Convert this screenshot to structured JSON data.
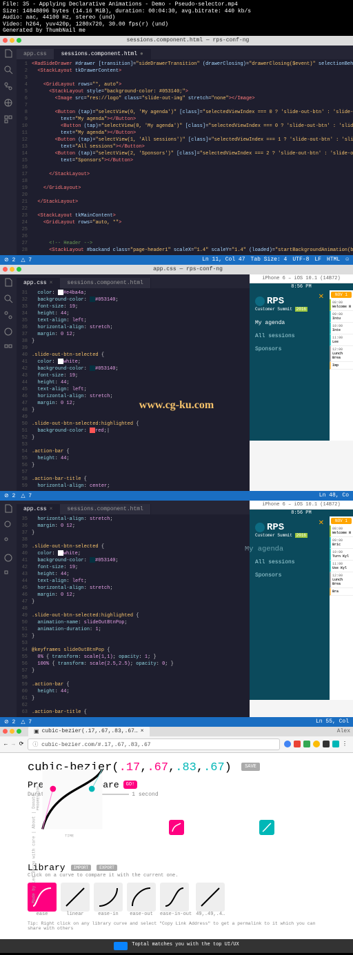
{
  "meta": {
    "l1": "File: 35 - Applying Declarative Animations - Demo - Pseudo-selector.mp4",
    "l2": "Size: 14848896 bytes (14.16 MiB), duration: 00:04:30, avg.bitrate: 440 kb/s",
    "l3": "Audio: aac, 44100 Hz, stereo (und)",
    "l4": "Video: h264, yuv420p, 1280x720, 30.00 fps(r) (und)",
    "l5": "Generated by ThumbNail me"
  },
  "tabs": {
    "css": "app.css",
    "html": "sessions.component.html"
  },
  "pane1": {
    "lines": [
      {
        "n": "1",
        "h": "<span class='t-tag'>&lt;RadSideDrawer</span> <span class='t-attr'>#drawer</span> <span class='t-attr'>[transition]</span>=<span class='t-str'>\"sideDrawerTransition\"</span> <span class='t-attr'>(drawerClosing)</span>=<span class='t-str'>\"drawerClosing($event)\"</span> <span class='t-attr'>selectionBehavior</span>=<span class='t-str'>\"None\"</span><span class='t-tag'>&gt;</span>"
      },
      {
        "n": "2",
        "h": "  <span class='t-tag'>&lt;StackLayout</span> <span class='t-attr'>tkDrawerContent</span><span class='t-tag'>&gt;</span>"
      },
      {
        "n": "3",
        "h": ""
      },
      {
        "n": "4",
        "h": "    <span class='t-tag'>&lt;GridLayout</span> <span class='t-attr'>rows</span>=<span class='t-str'>\"*, auto\"</span><span class='t-tag'>&gt;</span>"
      },
      {
        "n": "5",
        "h": "      <span class='t-tag'>&lt;StackLayout</span> <span class='t-attr'>style</span>=<span class='t-str'>\"background-color: #053140;\"</span><span class='t-tag'>&gt;</span>"
      },
      {
        "n": "6",
        "h": "        <span class='t-tag'>&lt;Image</span> <span class='t-attr'>src</span>=<span class='t-str'>\"res://logo\"</span> <span class='t-attr'>class</span>=<span class='t-str'>\"slide-out-img\"</span> <span class='t-attr'>stretch</span>=<span class='t-str'>\"none\"</span><span class='t-tag'>&gt;&lt;/Image&gt;</span>"
      },
      {
        "n": "7",
        "h": ""
      },
      {
        "n": "8",
        "h": "        <span class='t-tag'>&lt;Button</span> <span class='t-attr'>(tap)</span>=<span class='t-str'>\"selectView(0, 'My agenda')\"</span> <span class='t-attr'>[class]</span>=<span class='t-str'>\"selectedViewIndex === 0 ? 'slide-out-btn' : 'slide-out-btn-sel</span>"
      },
      {
        "n": "9",
        "h": "          <span class='t-attr'>text</span>=<span class='t-str'>\"My agenda\"</span><span class='t-tag'>&gt;&lt;/Button&gt;</span>"
      },
      {
        "n": "10",
        "h": "          <span class='t-tag'>&lt;Button</span> <span class='t-attr'>(tap)</span>=<span class='t-str'>\"selectView(0, 'My agenda')\"</span> <span class='t-attr'>[class]</span>=<span class='t-str'>\"selectedViewIndex === 0 ? 'slide-out-btn' : 'slide-out-btn</span>"
      },
      {
        "n": "11",
        "h": "          <span class='t-attr'>text</span>=<span class='t-str'>\"My agenda\"</span><span class='t-tag'>&gt;&lt;/Button&gt;</span>"
      },
      {
        "n": "12",
        "h": "        <span class='t-tag'>&lt;Button</span> <span class='t-attr'>(tap)</span>=<span class='t-str'>\"selectView(1, 'All sessions')\"</span> <span class='t-attr'>[class]</span>=<span class='t-str'>\"selectedViewIndex === 1 ? 'slide-out-btn' : 'slide-out-btn-se</span>"
      },
      {
        "n": "13",
        "h": "          <span class='t-attr'>text</span>=<span class='t-str'>\"All sessions\"</span><span class='t-tag'>&gt;&lt;/Button&gt;</span>"
      },
      {
        "n": "14",
        "h": "        <span class='t-tag'>&lt;Button</span> <span class='t-attr'>(tap)</span>=<span class='t-str'>\"selectView(2, 'Sponsors')\"</span> <span class='t-attr'>[class]</span>=<span class='t-str'>\"selectedViewIndex === 2 ? 'slide-out-btn' : 'slide-out-btn-select</span>"
      },
      {
        "n": "15",
        "h": "          <span class='t-attr'>text</span>=<span class='t-str'>\"Sponsors\"</span><span class='t-tag'>&gt;&lt;/Button&gt;</span>"
      },
      {
        "n": "16",
        "h": ""
      },
      {
        "n": "17",
        "h": "      <span class='t-tag'>&lt;/StackLayout&gt;</span>"
      },
      {
        "n": "18",
        "h": ""
      },
      {
        "n": "19",
        "h": "    <span class='t-tag'>&lt;/GridLayout&gt;</span>"
      },
      {
        "n": "20",
        "h": ""
      },
      {
        "n": "21",
        "h": "  <span class='t-tag'>&lt;/StackLayout&gt;</span>"
      },
      {
        "n": "22",
        "h": ""
      },
      {
        "n": "23",
        "h": "  <span class='t-tag'>&lt;StackLayout</span> <span class='t-attr'>tkMainContent</span><span class='t-tag'>&gt;</span>"
      },
      {
        "n": "24",
        "h": "    <span class='t-tag'>&lt;GridLayout</span> <span class='t-attr'>rows</span>=<span class='t-str'>\"auto, *\"</span><span class='t-tag'>&gt;</span>"
      },
      {
        "n": "25",
        "h": ""
      },
      {
        "n": "26",
        "h": ""
      },
      {
        "n": "27",
        "h": "      <span style='color:#6a9955'>&lt;!-- Header --&gt;</span>"
      },
      {
        "n": "28",
        "h": "      <span class='t-tag'>&lt;StackLayout</span> <span class='t-attr'>#backand</span> <span class='t-attr'>class</span>=<span class='t-str'>\"page-header1\"</span> <span class='t-attr'>scaleX</span>=<span class='t-str'>\"1.4\"</span> <span class='t-attr'>scaleY</span>=<span class='t-str'>\"1.4\"</span> <span class='t-attr'>(loaded)</span>=<span class='t-str'>\"startBackgroundAnimation(backgroun</span>"
      }
    ]
  },
  "status1": {
    "left": [
      "⊘ 2",
      "△ 7"
    ],
    "right": [
      "Ln 11, Col 47",
      "Tab Size: 4",
      "UTF-8",
      "LF",
      "HTML",
      "☺"
    ]
  },
  "titlebar": {
    "main": "sessions.component.html — rps-conf-ng",
    "sub": "app.css — rps-conf-ng"
  },
  "pane2": {
    "lines": [
      {
        "n": "31",
        "h": "  <span class='t-prop'>color</span>: <span class='sw-w'></span><span class='t-val'>#e4ba4a</span>;"
      },
      {
        "n": "32",
        "h": "  <span class='t-prop'>background-color</span>: <span class='sw-d'></span><span class='t-val'>#053140</span>;"
      },
      {
        "n": "33",
        "h": "  <span class='t-prop'>font-size</span>: <span class='t-val'>19</span>;"
      },
      {
        "n": "34",
        "h": "  <span class='t-prop'>height</span>: <span class='t-val'>44</span>;"
      },
      {
        "n": "35",
        "h": "  <span class='t-prop'>text-align</span>: <span class='t-val'>left</span>;"
      },
      {
        "n": "36",
        "h": "  <span class='t-prop'>horizontal-align</span>: <span class='t-val'>stretch</span>;"
      },
      {
        "n": "37",
        "h": "  <span class='t-prop'>margin</span>: <span class='t-val'>0 12</span>;"
      },
      {
        "n": "38",
        "h": "}"
      },
      {
        "n": "39",
        "h": ""
      },
      {
        "n": "40",
        "h": "<span class='t-sel'>.slide-out-btn-selected</span> {"
      },
      {
        "n": "41",
        "h": "  <span class='t-prop'>color</span>: <span class='sw-w'></span><span class='t-val'>white</span>;"
      },
      {
        "n": "42",
        "h": "  <span class='t-prop'>background-color</span>: <span class='sw-d'></span><span class='t-val'>#053140</span>;"
      },
      {
        "n": "43",
        "h": "  <span class='t-prop'>font-size</span>: <span class='t-val'>19</span>;"
      },
      {
        "n": "44",
        "h": "  <span class='t-prop'>height</span>: <span class='t-val'>44</span>;"
      },
      {
        "n": "45",
        "h": "  <span class='t-prop'>text-align</span>: <span class='t-val'>left</span>;"
      },
      {
        "n": "46",
        "h": "  <span class='t-prop'>horizontal-align</span>: <span class='t-val'>stretch</span>;"
      },
      {
        "n": "47",
        "h": "  <span class='t-prop'>margin</span>: <span class='t-val'>0 12</span>;"
      },
      {
        "n": "48",
        "h": "}"
      },
      {
        "n": "49",
        "h": ""
      },
      {
        "n": "50",
        "h": "<span class='t-sel'>.slide-out-btn-selected:highlighted</span> {"
      },
      {
        "n": "51",
        "h": "  <span class='t-prop'>background-color</span>: <span class='sw-r'></span><span class='t-val'>red</span>;|"
      },
      {
        "n": "52",
        "h": "}"
      },
      {
        "n": "53",
        "h": ""
      },
      {
        "n": "54",
        "h": "<span class='t-sel'>.action-bar</span> {"
      },
      {
        "n": "55",
        "h": "  <span class='t-prop'>height</span>: <span class='t-val'>44</span>;"
      },
      {
        "n": "56",
        "h": "}"
      },
      {
        "n": "57",
        "h": ""
      },
      {
        "n": "58",
        "h": "<span class='t-sel'>.action-bar-title</span> {"
      },
      {
        "n": "59",
        "h": "  <span class='t-prop'>horizontal-align</span>: <span class='t-val'>center</span>;"
      }
    ]
  },
  "status2": {
    "left": [
      "⊘ 2",
      "△ 7"
    ],
    "right": [
      "Ln 48, Co"
    ]
  },
  "pane3": {
    "lines": [
      {
        "n": "35",
        "h": "  <span class='t-prop'>horizontal-align</span>: <span class='t-val'>stretch</span>;"
      },
      {
        "n": "36",
        "h": "  <span class='t-prop'>margin</span>: <span class='t-val'>0 12</span>;"
      },
      {
        "n": "37",
        "h": "}"
      },
      {
        "n": "38",
        "h": ""
      },
      {
        "n": "39",
        "h": "<span class='t-sel'>.slide-out-btn-selected</span> {"
      },
      {
        "n": "40",
        "h": "  <span class='t-prop'>color</span>: <span class='sw-w'></span><span class='t-val'>white</span>;"
      },
      {
        "n": "41",
        "h": "  <span class='t-prop'>background-color</span>: <span class='sw-d'></span><span class='t-val'>#053140</span>;"
      },
      {
        "n": "42",
        "h": "  <span class='t-prop'>font-size</span>: <span class='t-val'>19</span>;"
      },
      {
        "n": "43",
        "h": "  <span class='t-prop'>height</span>: <span class='t-val'>44</span>;"
      },
      {
        "n": "44",
        "h": "  <span class='t-prop'>text-align</span>: <span class='t-val'>left</span>;"
      },
      {
        "n": "45",
        "h": "  <span class='t-prop'>horizontal-align</span>: <span class='t-val'>stretch</span>;"
      },
      {
        "n": "46",
        "h": "  <span class='t-prop'>margin</span>: <span class='t-val'>0 12</span>;"
      },
      {
        "n": "47",
        "h": "}"
      },
      {
        "n": "48",
        "h": ""
      },
      {
        "n": "49",
        "h": "<span class='t-sel'>.slide-out-btn-selected:highlighted</span> {"
      },
      {
        "n": "50",
        "h": "  <span class='t-prop'>animation-name</span>: <span class='t-val'>slideOutBtnPop</span>;"
      },
      {
        "n": "51",
        "h": "  <span class='t-prop'>animation-duration</span>: <span class='t-val'>1</span>;"
      },
      {
        "n": "52",
        "h": "}"
      },
      {
        "n": "53",
        "h": ""
      },
      {
        "n": "54",
        "h": "<span class='t-sel'>@keyframes slideOutBtnPop</span> {"
      },
      {
        "n": "55",
        "h": "  <span class='t-val'>0%</span> { <span class='t-prop'>transform</span>: <span class='t-val'>scale(1,1)</span>; <span class='t-prop'>opacity</span>: <span class='t-val'>1</span>; }"
      },
      {
        "n": "56",
        "h": "  <span class='t-val'>100%</span> { <span class='t-prop'>transform</span>: <span class='t-val'>scale(2.5,2.5)</span>; <span class='t-prop'>opacity</span>: <span class='t-val'>0</span>; }"
      },
      {
        "n": "57",
        "h": "}"
      },
      {
        "n": "58",
        "h": ""
      },
      {
        "n": "59",
        "h": "<span class='t-sel'>.action-bar</span> {"
      },
      {
        "n": "60",
        "h": "  <span class='t-prop'>height</span>: <span class='t-val'>44</span>;"
      },
      {
        "n": "61",
        "h": "}"
      },
      {
        "n": "62",
        "h": ""
      },
      {
        "n": "63",
        "h": "<span class='t-sel'>.action-bar-title</span> {"
      }
    ]
  },
  "status3": {
    "left": [
      "⊘ 2",
      "△ 7"
    ],
    "right": [
      "Ln 55, Col"
    ]
  },
  "sim": {
    "hdr": "iPhone 6 – iOS 10.1 (14B72)",
    "time": "8:56 PM",
    "logo": "RPS",
    "logoSub": "Customer Summit",
    "logoYear": "2016",
    "nav": {
      "agenda": "My agenda",
      "sessions": "All sessions",
      "sponsors": "Sponsors"
    },
    "date": "NOV 1",
    "sessions": [
      {
        "t": "08:00",
        "s": "Welcome N"
      },
      {
        "t": "09:00",
        "s": "Intu"
      },
      {
        "t": "10:00",
        "s": "Inte"
      },
      {
        "t": "11:00",
        "s": "Lee"
      },
      {
        "t": "12:00",
        "s": "Lunch Brea"
      },
      {
        "t": "",
        "s": "Imp"
      }
    ],
    "sessions3": [
      {
        "t": "08:00",
        "s": "Welcome N"
      },
      {
        "t": "09:00",
        "s": "Bric"
      },
      {
        "t": "10:00",
        "s": "Turn\nKyl"
      },
      {
        "t": "11:00",
        "s": "Use\nKyl"
      },
      {
        "t": "12:00",
        "s": "Lunch Brea"
      },
      {
        "t": "",
        "s": "Bra"
      }
    ]
  },
  "watermark": "www.cg-ku.com",
  "browser": {
    "tab": "cubic-bezier(.17,.67,.83,.67…",
    "url": "cubic-bezier.com/#.17,.67,.83,.67",
    "user": "Alex"
  },
  "cb": {
    "prefix": "cubic-bezier(",
    "v1": ".17",
    "c1": ",",
    "v2": ".67",
    "c2": ",",
    "v3": ".83",
    "c3": ",",
    "v4": ".67",
    "suffix": ")",
    "save": "SAVE",
    "preview": "Preview & compare",
    "go": "GO!",
    "durLabel": "Duration:",
    "durVal": "1 second",
    "library": "Library",
    "import": "IMPORT",
    "export": "EXPORT",
    "libSub": "Click on a curve to compare it with the current one.",
    "items": [
      "ease",
      "linear",
      "ease-in",
      "ease-out",
      "ease-in-out",
      "49,.49,.4…"
    ],
    "tip": "Tip: Right click on any library curve and select \"Copy Link Address\" to get a permalink to it which you can share with others",
    "side": "Made by Lea Verou with care | About | Donate",
    "progression": "PROGRESSION",
    "time": "TIME"
  },
  "ad": "Toptal matches you with the top UI/UX"
}
